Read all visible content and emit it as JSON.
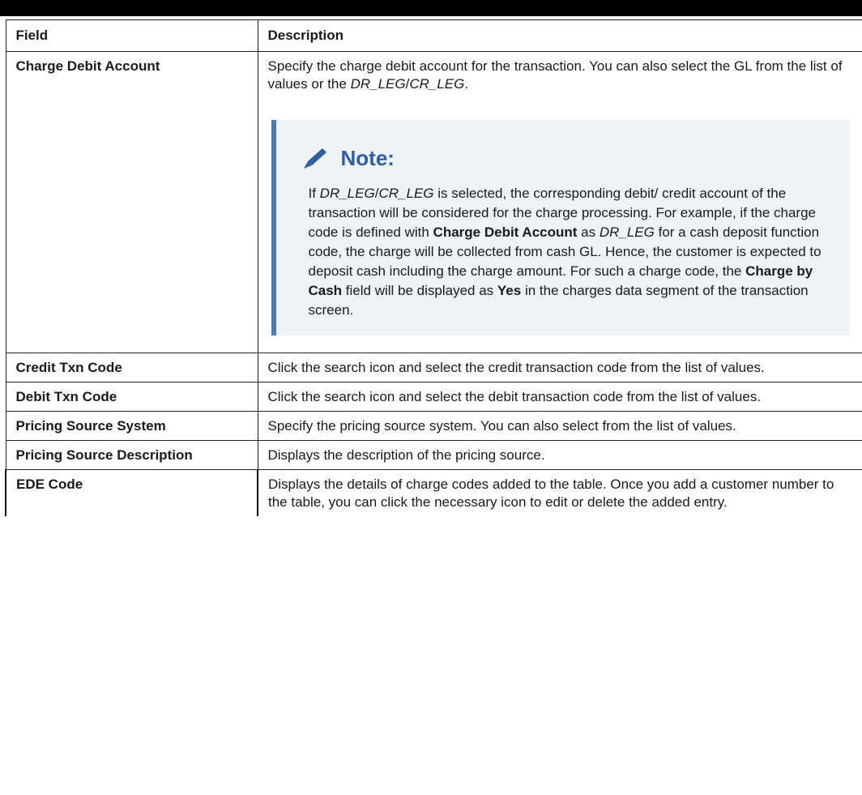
{
  "table": {
    "headers": [
      "Field",
      "Description"
    ],
    "rows": [
      {
        "field": "Charge Debit Account",
        "desc": {
          "t1": "Specify the charge debit account for the transaction. You can also select the GL from the list of values or the ",
          "i1": "DR_LEG",
          "t2": "/",
          "i2": "CR_LEG",
          "t3": "."
        },
        "note": {
          "title": "Note:",
          "icon": "pencil-icon",
          "s1": "If ",
          "i1": "DR_LEG",
          "s2": "/",
          "i2": "CR_LEG",
          "s3": " is selected, the corresponding debit/ credit account of the transaction will be considered for the charge processing. For example, if the charge code is defined with ",
          "b1": "Charge Debit Account",
          "s4": " as ",
          "i3": "DR_LEG",
          "s5": " for a cash deposit function code, the charge will be collected from cash GL. Hence, the customer is expected to deposit cash including the charge amount. For such a charge code, the ",
          "b2": "Charge by Cash",
          "s6": " field will be displayed as ",
          "b3": "Yes",
          "s7": " in the charges data segment of the transaction screen."
        }
      },
      {
        "field": "Credit Txn Code",
        "desc": "Click the search icon and select the credit transaction code from the list of values."
      },
      {
        "field": "Debit Txn Code",
        "desc": "Click the search icon and select the debit transaction code from the list of values."
      },
      {
        "field": "Pricing Source System",
        "desc": "Specify the pricing source system. You can also select from the list of values."
      },
      {
        "field": "Pricing Source Description",
        "desc": "Displays the description of the pricing source."
      },
      {
        "field": "EDE Code",
        "desc": "Displays the details of charge codes added to the table. Once you add a customer number to the table, you can click the necessary icon to edit or delete the added entry."
      }
    ]
  },
  "colors": {
    "note_accent": "#4a7ab4",
    "note_title": "#2f5f9e",
    "note_bg": "#eef3f8"
  }
}
